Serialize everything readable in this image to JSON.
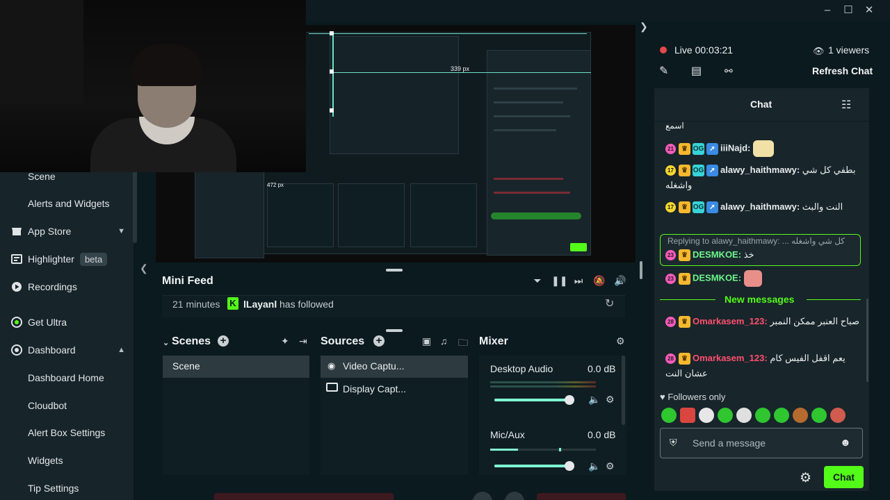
{
  "window": {
    "minimize_icon": "minimize-icon",
    "maximize_icon": "maximize-icon",
    "close_icon": "close-icon"
  },
  "sidebar": {
    "items": [
      {
        "label": "Scene",
        "type": "sub"
      },
      {
        "label": "Alerts and Widgets",
        "type": "sub"
      },
      {
        "label": "App Store",
        "icon": "store-icon",
        "chevron": "down"
      },
      {
        "label": "Highlighter",
        "icon": "highlighter-icon",
        "badge": "beta"
      },
      {
        "label": "Recordings",
        "icon": "play-circle-icon"
      },
      {
        "label": "Get Ultra",
        "icon": "ultra-icon"
      },
      {
        "label": "Dashboard",
        "icon": "dashboard-icon",
        "chevron": "up"
      },
      {
        "label": "Dashboard Home",
        "type": "sub"
      },
      {
        "label": "Cloudbot",
        "type": "sub"
      },
      {
        "label": "Alert Box Settings",
        "type": "sub"
      },
      {
        "label": "Widgets",
        "type": "sub"
      },
      {
        "label": "Tip Settings",
        "type": "sub"
      }
    ]
  },
  "preview": {
    "size_readout_1": "339 px",
    "size_readout_2": "472 px"
  },
  "minifeed": {
    "title": "Mini Feed",
    "event": {
      "time": "21 minutes",
      "platform_badge": "K",
      "user": "lLayanl",
      "action": "has followed"
    }
  },
  "scenes": {
    "title": "Scenes",
    "items": [
      "Scene"
    ]
  },
  "sources": {
    "title": "Sources",
    "items": [
      {
        "label": "Video Captu...",
        "icon": "webcam-icon"
      },
      {
        "label": "Display Capt...",
        "icon": "monitor-icon"
      }
    ]
  },
  "mixer": {
    "title": "Mixer",
    "channels": [
      {
        "name": "Desktop Audio",
        "db": "0.0 dB",
        "volume": 0.9
      },
      {
        "name": "Mic/Aux",
        "db": "0.0 dB",
        "volume": 0.9
      }
    ]
  },
  "stream": {
    "status": "Live",
    "time": "00:03:21",
    "viewers": "1 viewers",
    "refresh_label": "Refresh Chat"
  },
  "chat": {
    "title": "Chat",
    "partial_top": "اسمع",
    "messages": [
      {
        "level": "21",
        "user": "iiiNajd:",
        "text": "",
        "user_color": "#e8ecee",
        "emote": true
      },
      {
        "level": "17",
        "user": "alawy_haithmawy:",
        "text": "بطفي كل شي واشغله",
        "user_color": "#e8ecee"
      },
      {
        "level": "17",
        "user": "alawy_haithmawy:",
        "text": "النت والبث",
        "user_color": "#e8ecee"
      },
      {
        "level": "23",
        "user": "DESMKOE:",
        "text": "خذ",
        "user_color": "#6ef58a"
      },
      {
        "level": "23",
        "user": "DESMKOE:",
        "text": "",
        "user_color": "#6ef58a",
        "emote": true
      },
      {
        "level": "28",
        "user": "Omarkasem_123:",
        "text": "صباح العنبر ممكن النمبر",
        "user_color": "#ff4f6e"
      },
      {
        "level": "28",
        "user": "Omarkasem_123:",
        "text": "يعم اقفل الفيس كام عشان النت",
        "user_color": "#ff4f6e"
      }
    ],
    "reply_label": "Replying to alawy_haithmawy: ... كل شي واشغله",
    "new_messages": "New messages",
    "followers_only": "Followers only",
    "input_placeholder": "Send a message",
    "send_label": "Chat"
  },
  "colors": {
    "accent_green": "#53fc18",
    "live_red": "#e5484d",
    "teal": "#80f5d2"
  }
}
